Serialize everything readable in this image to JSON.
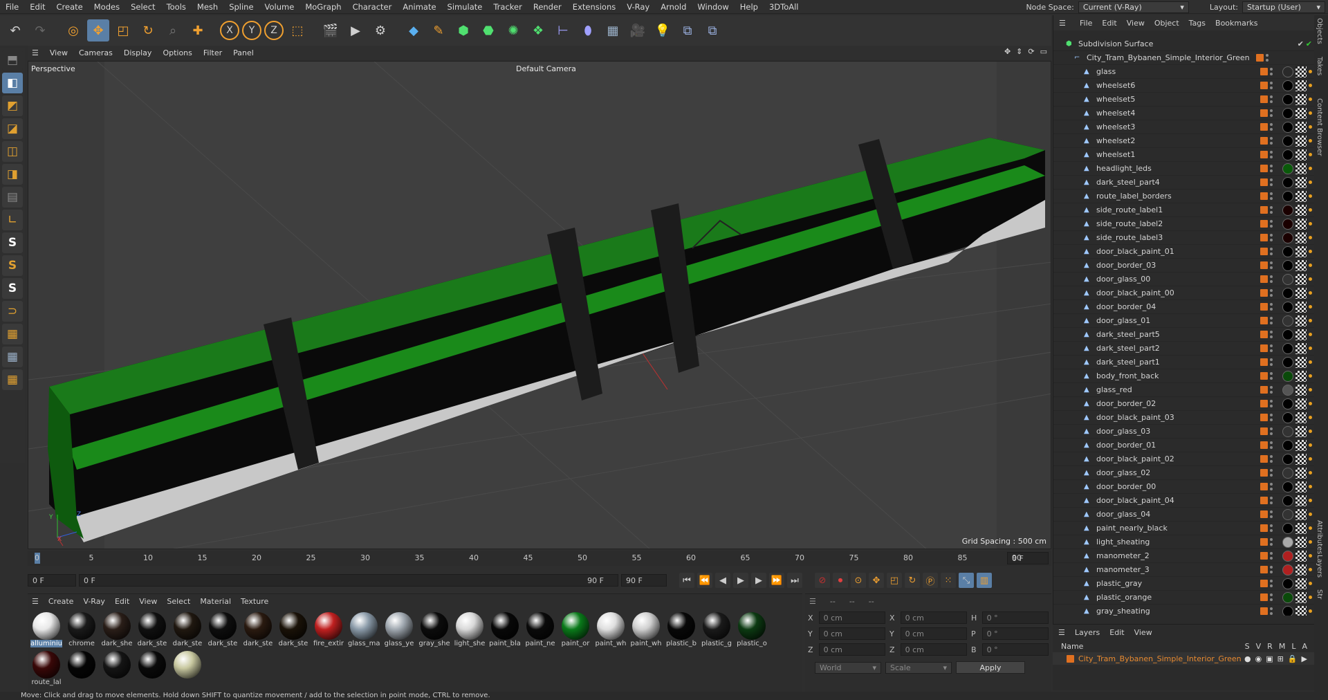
{
  "menu": {
    "items": [
      "File",
      "Edit",
      "Create",
      "Modes",
      "Select",
      "Tools",
      "Mesh",
      "Spline",
      "Volume",
      "MoGraph",
      "Character",
      "Animate",
      "Simulate",
      "Tracker",
      "Render",
      "Extensions",
      "V-Ray",
      "Arnold",
      "Window",
      "Help",
      "3DToAll"
    ],
    "node_space_label": "Node Space:",
    "node_space_value": "Current (V-Ray)",
    "layout_label": "Layout:",
    "layout_value": "Startup (User)"
  },
  "viewport": {
    "menu": [
      "View",
      "Cameras",
      "Display",
      "Options",
      "Filter",
      "Panel"
    ],
    "name": "Perspective",
    "camera": "Default Camera",
    "grid_spacing": "Grid Spacing : 500 cm",
    "axis_x": "X",
    "axis_y": "Y",
    "axis_z": "Z"
  },
  "timeline": {
    "ticks": [
      "0",
      "5",
      "10",
      "15",
      "20",
      "25",
      "30",
      "35",
      "40",
      "45",
      "50",
      "55",
      "60",
      "65",
      "70",
      "75",
      "80",
      "85",
      "90"
    ],
    "current_frame_right": "0 F"
  },
  "transport": {
    "start": "0 F",
    "range_start": "0 F",
    "range_end": "90 F",
    "end": "90 F"
  },
  "materials": {
    "menu": [
      "Create",
      "V-Ray",
      "Edit",
      "View",
      "Select",
      "Material",
      "Texture"
    ],
    "items": [
      {
        "name": "alluminiu",
        "color": "#e8e8e8"
      },
      {
        "name": "chrome",
        "color": "#1a1a1a"
      },
      {
        "name": "dark_she",
        "color": "#2a1e18"
      },
      {
        "name": "dark_ste",
        "color": "#101010"
      },
      {
        "name": "dark_ste",
        "color": "#201810"
      },
      {
        "name": "dark_ste",
        "color": "#0e0e0e"
      },
      {
        "name": "dark_ste",
        "color": "#2a1a10"
      },
      {
        "name": "dark_ste",
        "color": "#1a1208"
      },
      {
        "name": "fire_extir",
        "color": "#c02020"
      },
      {
        "name": "glass_ma",
        "color": "#8a9aa8"
      },
      {
        "name": "glass_ye",
        "color": "#a0a8b0"
      },
      {
        "name": "gray_she",
        "color": "#0c0c0c"
      },
      {
        "name": "light_she",
        "color": "#d8d8d8"
      },
      {
        "name": "paint_bla",
        "color": "#080808"
      },
      {
        "name": "paint_ne",
        "color": "#0a0a0a"
      },
      {
        "name": "paint_or",
        "color": "#0a7a1a"
      },
      {
        "name": "paint_wh",
        "color": "#dedede"
      },
      {
        "name": "paint_wh",
        "color": "#cfcfcf"
      },
      {
        "name": "plastic_b",
        "color": "#080808"
      },
      {
        "name": "plastic_g",
        "color": "#1a1a1a"
      },
      {
        "name": "plastic_o",
        "color": "#0c3a12"
      },
      {
        "name": "route_lal",
        "color": "#3a0808"
      },
      {
        "name": "",
        "color": "#050505"
      },
      {
        "name": "",
        "color": "#151515"
      },
      {
        "name": "",
        "color": "#0a0a0a"
      },
      {
        "name": "",
        "color": "#c8c8a0"
      }
    ]
  },
  "coords": {
    "x": "0 cm",
    "y": "0 cm",
    "z": "0 cm",
    "x2": "0 cm",
    "y2": "0 cm",
    "z2": "0 cm",
    "h": "0 °",
    "p": "0 °",
    "b": "0 °",
    "world": "World",
    "scale": "Scale",
    "apply": "Apply"
  },
  "status": "Move: Click and drag to move elements. Hold down SHIFT to quantize movement / add to the selection in point mode, CTRL to remove.",
  "objects": {
    "menu": [
      "File",
      "Edit",
      "View",
      "Object",
      "Tags",
      "Bookmarks"
    ],
    "root": "Subdivision Surface",
    "group": "City_Tram_Bybanen_Simple_Interior_Green",
    "items": [
      "glass",
      "wheelset6",
      "wheelset5",
      "wheelset4",
      "wheelset3",
      "wheelset2",
      "wheelset1",
      "headlight_leds",
      "dark_steel_part4",
      "route_label_borders",
      "side_route_label1",
      "side_route_label2",
      "side_route_label3",
      "door_black_paint_01",
      "door_border_03",
      "door_glass_00",
      "door_black_paint_00",
      "door_border_04",
      "door_glass_01",
      "dark_steel_part5",
      "dark_steel_part2",
      "dark_steel_part1",
      "body_front_back",
      "glass_red",
      "door_border_02",
      "door_black_paint_03",
      "door_glass_03",
      "door_border_01",
      "door_black_paint_02",
      "door_glass_02",
      "door_border_00",
      "door_black_paint_04",
      "door_glass_04",
      "paint_nearly_black",
      "light_sheating",
      "manometer_2",
      "manometer_3",
      "plastic_gray",
      "plastic_orange",
      "gray_sheating"
    ]
  },
  "layers": {
    "menu": [
      "Layers",
      "Edit",
      "View"
    ],
    "name_header": "Name",
    "cols": [
      "S",
      "V",
      "R",
      "M",
      "L",
      "A"
    ],
    "row": "City_Tram_Bybanen_Simple_Interior_Green"
  },
  "sidetabs": [
    "Objects",
    "Takes",
    "Content Browser",
    "Attributes",
    "Layers",
    "Str"
  ]
}
